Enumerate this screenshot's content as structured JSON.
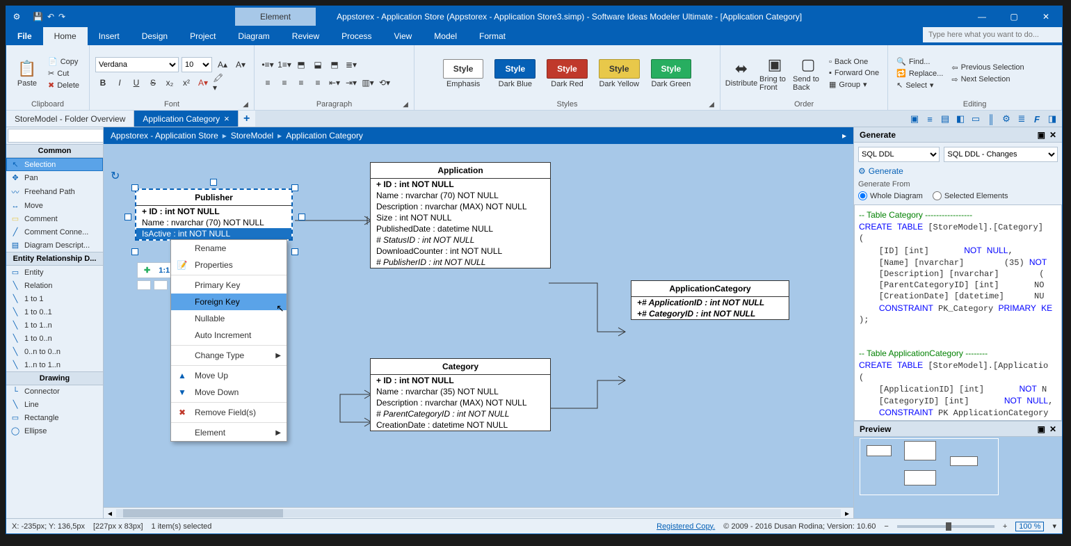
{
  "titlebar": {
    "contextual_tab": "Element",
    "title": "Appstorex - Application Store (Appstorex - Application Store3.simp)  - Software Ideas Modeler Ultimate - [Application Category]"
  },
  "menubar": {
    "items": [
      "File",
      "Home",
      "Insert",
      "Design",
      "Project",
      "Diagram",
      "Review",
      "Process",
      "View",
      "Model",
      "Format"
    ],
    "active": "Home",
    "search_placeholder": "Type here what you want to do..."
  },
  "ribbon": {
    "clipboard": {
      "paste": "Paste",
      "copy": "Copy",
      "cut": "Cut",
      "delete": "Delete",
      "label": "Clipboard"
    },
    "font": {
      "family": "Verdana",
      "size": "10",
      "label": "Font"
    },
    "paragraph": {
      "label": "Paragraph"
    },
    "styles": {
      "label": "Styles",
      "items": [
        "Emphasis",
        "Dark Blue",
        "Dark Red",
        "Dark Yellow",
        "Dark Green"
      ],
      "pill_text": "Style"
    },
    "order": {
      "label": "Order",
      "distribute": "Distribute",
      "bring_front": "Bring to Front",
      "send_back": "Send to Back",
      "back_one": "Back One",
      "forward_one": "Forward One",
      "group": "Group"
    },
    "editing": {
      "label": "Editing",
      "find": "Find...",
      "replace": "Replace...",
      "select": "Select",
      "prev_sel": "Previous Selection",
      "next_sel": "Next Selection"
    }
  },
  "tabs": {
    "inactive": "StoreModel - Folder Overview",
    "active": "Application Category"
  },
  "breadcrumb": [
    "Appstorex - Application Store",
    "StoreModel",
    "Application Category"
  ],
  "toolbox": {
    "sections": {
      "common": {
        "title": "Common",
        "items": [
          "Selection",
          "Pan",
          "Freehand Path",
          "Move",
          "Comment",
          "Comment Conne...",
          "Diagram Descript..."
        ]
      },
      "erd": {
        "title": "Entity Relationship D...",
        "items": [
          "Entity",
          "Relation",
          "1 to 1",
          "1 to 0..1",
          "1 to 1..n",
          "1 to 0..n",
          "0..n to 0..n",
          "1..n to 1..n"
        ]
      },
      "drawing": {
        "title": "Drawing",
        "items": [
          "Connector",
          "Line",
          "Rectangle",
          "Ellipse"
        ]
      }
    },
    "selected": "Selection"
  },
  "entities": {
    "publisher": {
      "name": "Publisher",
      "rows": [
        "+ ID : int NOT NULL",
        "Name : nvarchar (70)  NOT NULL",
        "IsActive : int NOT NULL"
      ],
      "hl_row": 2
    },
    "application": {
      "name": "Application",
      "rows": [
        "+ ID : int NOT NULL",
        "Name : nvarchar (70)  NOT NULL",
        "Description : nvarchar (MAX)  NOT NULL",
        "Size : int NOT NULL",
        "PublishedDate : datetime NULL",
        "# StatusID : int NOT NULL",
        "DownloadCounter : int NOT NULL",
        "# PublisherID : int NOT NULL"
      ]
    },
    "appcat": {
      "name": "ApplicationCategory",
      "rows": [
        "+# ApplicationID : int NOT NULL",
        "+# CategoryID : int NOT NULL"
      ]
    },
    "category": {
      "name": "Category",
      "rows": [
        "+ ID : int NOT NULL",
        "Name : nvarchar (35)  NOT NULL",
        "Description : nvarchar (MAX)  NOT NULL",
        "# ParentCategoryID : int NOT NULL",
        "CreationDate : datetime NOT NULL"
      ]
    }
  },
  "relbar": {
    "rel": "1:1"
  },
  "contextmenu": {
    "items": [
      {
        "label": "Rename"
      },
      {
        "label": "Properties",
        "icon": "📝"
      },
      {
        "sep": true
      },
      {
        "label": "Primary Key"
      },
      {
        "label": "Foreign Key",
        "hover": true
      },
      {
        "label": "Nullable"
      },
      {
        "label": "Auto Increment"
      },
      {
        "sep": true
      },
      {
        "label": "Change Type",
        "sub": true
      },
      {
        "sep": true
      },
      {
        "label": "Move Up",
        "icon": "▲"
      },
      {
        "label": "Move Down",
        "icon": "▼"
      },
      {
        "sep": true
      },
      {
        "label": "Remove Field(s)",
        "icon": "✖"
      },
      {
        "sep": true
      },
      {
        "label": "Element",
        "sub": true
      }
    ]
  },
  "rightpanel": {
    "generate_title": "Generate",
    "dropdown1": "SQL DDL",
    "dropdown2": "SQL DDL - Changes",
    "generate_link": "Generate",
    "from_label": "Generate From",
    "radio1": "Whole Diagram",
    "radio2": "Selected Elements",
    "preview_title": "Preview",
    "sql": "-- Table Category -----------------\nCREATE TABLE [StoreModel].[Category]\n(\n    [ID] [int]       NOT NULL,\n    [Name] [nvarchar]        (35) NOT\n    [Description] [nvarchar]        (\n    [ParentCategoryID] [int]       NO\n    [CreationDate] [datetime]      NU\n    CONSTRAINT PK_Category PRIMARY KE\n);\n\n\n-- Table ApplicationCategory --------\nCREATE TABLE [StoreModel].[Applicatio\n(\n    [ApplicationID] [int]       NOT N\n    [CategoryID] [int]       NOT NULL,\n    CONSTRAINT PK ApplicationCategory"
  },
  "statusbar": {
    "coords": "X: -235px; Y: 136,5px",
    "size": "[227px x 83px]",
    "sel": "1 item(s) selected",
    "registered": "Registered Copy.",
    "copyright": "© 2009 - 2016 Dusan Rodina; Version: 10.60",
    "zoom": "100 %"
  }
}
